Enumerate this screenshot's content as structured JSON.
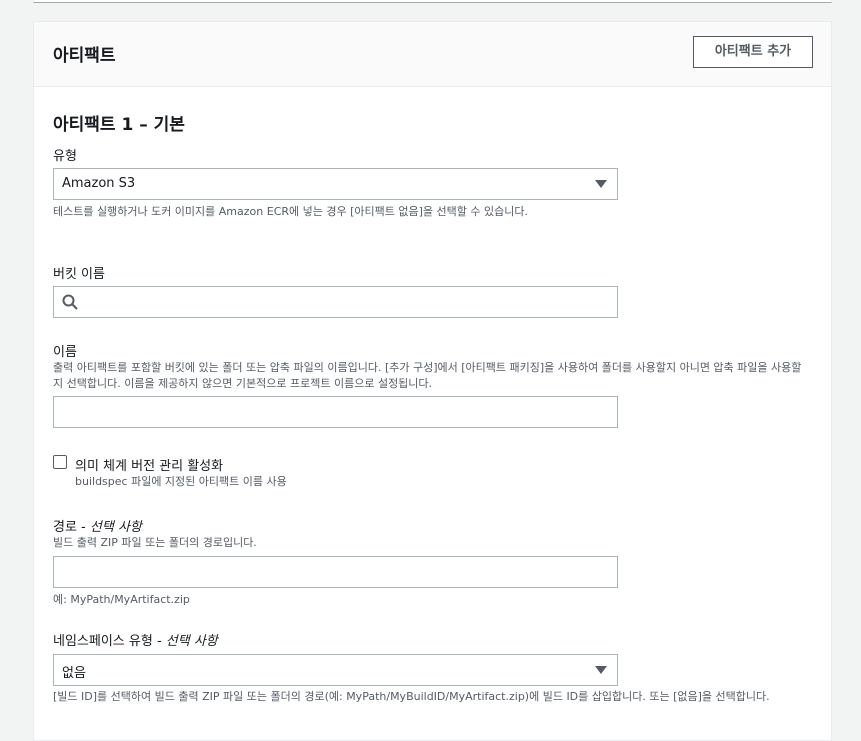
{
  "panel": {
    "title": "아티팩트",
    "add_button": "아티팩트 추가"
  },
  "artifact": {
    "section_title": "아티팩트 1 – 기본",
    "type": {
      "label": "유형",
      "value": "Amazon S3",
      "description": "테스트를 실행하거나 도커 이미지를 Amazon ECR에 넣는 경우 [아티팩트 없음]을 선택할 수 있습니다."
    },
    "bucket": {
      "label": "버킷 이름",
      "value": ""
    },
    "name": {
      "label": "이름",
      "description_line1": "출력 아티팩트를 포함할 버킷에 있는 폴더 또는 압축 파일의 이름입니다. [추가 구성]에서 [아티팩트 패키징]을 사용하여 폴더를 사용할지 아니면 압축 파일을 사용할",
      "description_line2": "지 선택합니다. 이름을 제공하지 않으면 기본적으로 프로젝트 이름으로 설정됩니다.",
      "value": ""
    },
    "semantic_versioning": {
      "label": "의미 체계 버전 관리 활성화",
      "description": "buildspec 파일에 지정된 아티팩트 이름 사용",
      "checked": false
    },
    "path": {
      "label": "경로 - ",
      "label_optional": "선택 사항",
      "description": "빌드 출력 ZIP 파일 또는 폴더의 경로입니다.",
      "value": "",
      "hint": "예: MyPath/MyArtifact.zip"
    },
    "namespace_type": {
      "label": "네임스페이스 유형 - ",
      "label_optional": "선택 사항",
      "value": "없음",
      "description": "[빌드 ID]를 선택하여 빌드 출력 ZIP 파일 또는 폴더의 경로(예: MyPath/MyBuildID/MyArtifact.zip)에 빌드 ID를 삽입합니다. 또는 [없음]을 선택합니다."
    }
  },
  "colors": {
    "background": "#f2f3f3",
    "panel": "#ffffff",
    "header": "#fafafa",
    "text": "#16191f",
    "muted": "#545b64",
    "border": "#aab7b8"
  }
}
